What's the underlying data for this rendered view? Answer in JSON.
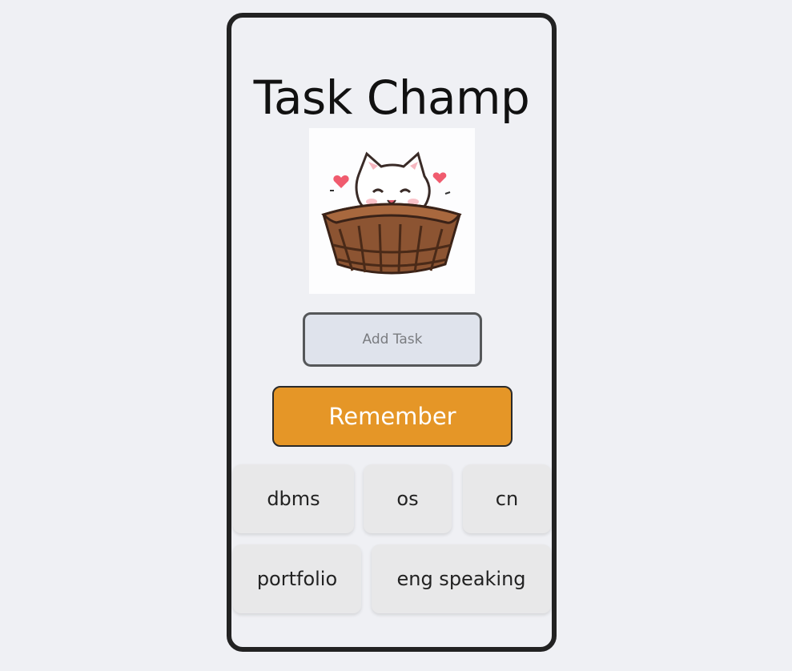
{
  "app": {
    "title": "Task Champ"
  },
  "mascot": {
    "icon": "cat-in-basket-icon"
  },
  "task_input": {
    "value": "",
    "placeholder": "Add Task"
  },
  "remember_button": {
    "label": "Remember"
  },
  "tasks": [
    {
      "label": "dbms"
    },
    {
      "label": "os"
    },
    {
      "label": "cn"
    },
    {
      "label": "portfolio"
    },
    {
      "label": "eng speaking"
    }
  ],
  "colors": {
    "background": "#eff0f4",
    "frame_border": "#222222",
    "button_accent": "#e59627",
    "input_fill": "#dfe3ec",
    "card_fill": "#e8e8e9"
  }
}
